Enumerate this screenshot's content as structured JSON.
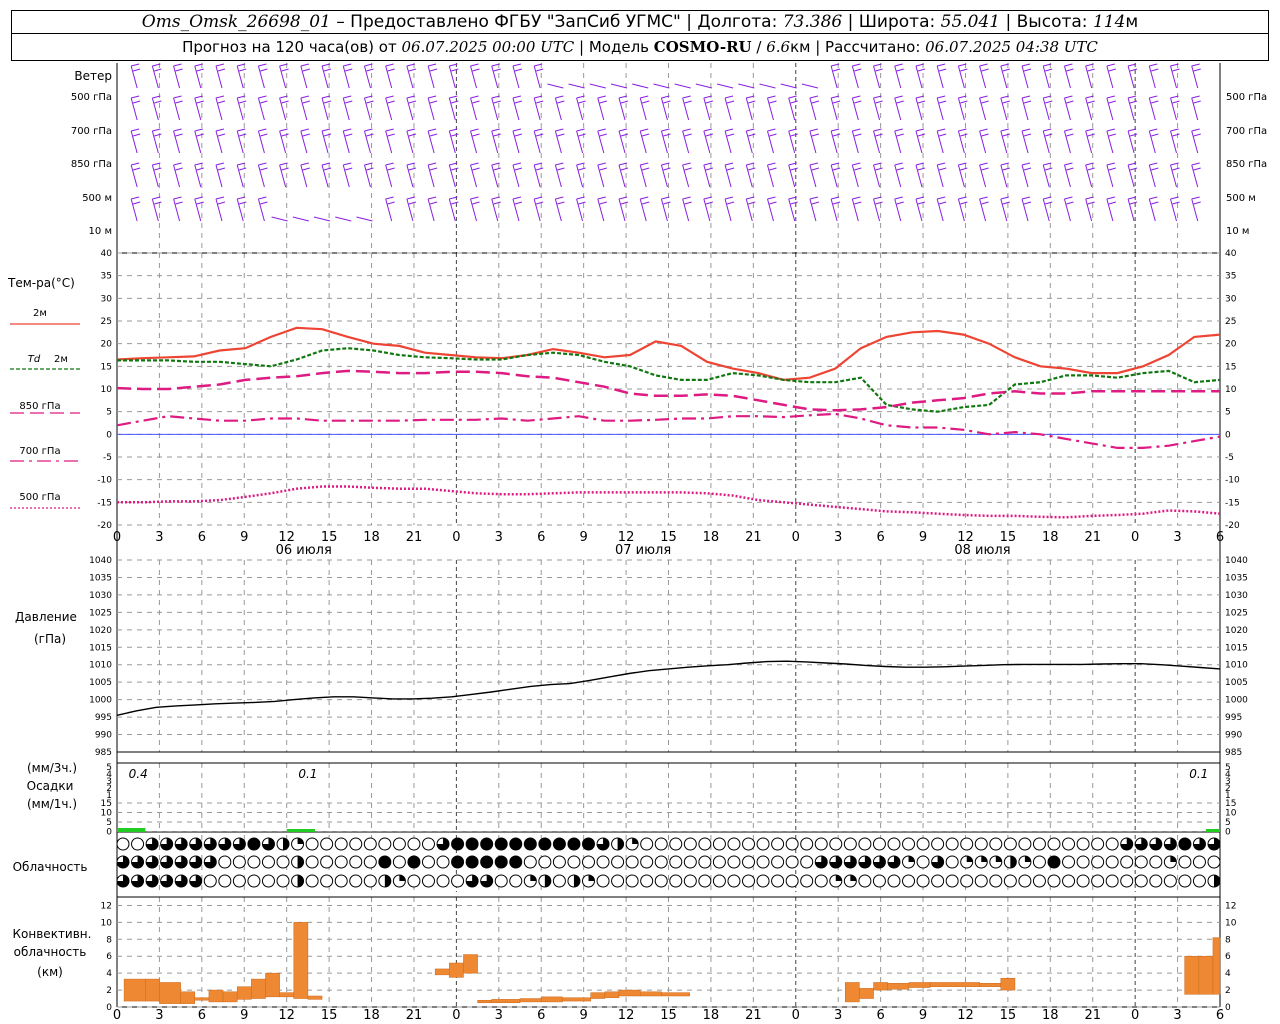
{
  "header": {
    "station": "Oms_Omsk_26698_01",
    "provider": " – Предоставлено ФГБУ \"ЗапСиб УГМС\" | Долгота: ",
    "lon": "73.386",
    "lat_label": " | Широта: ",
    "lat": "55.041",
    "alt_label": " | Высота: ",
    "alt": "114",
    "alt_unit": "м",
    "forecast_prefix": "Прогноз на 120 часа(ов) от ",
    "forecast_from": "06.07.2025 00:00 UTC",
    "model_label": " | Модель ",
    "model": "COSMO-RU",
    "model_sep": " / ",
    "res": "6.6",
    "res_unit": "км",
    "calc_label": " | Рассчитано: ",
    "calc_time": "06.07.2025 04:38 UTC"
  },
  "colors": {
    "wind": "#8a1ee0",
    "t2m": "#ee4433",
    "td2m": "#117711",
    "t850": "#dd1b83",
    "t700": "#dd1b83",
    "t500": "#dd1b83",
    "zero": "#4455ff",
    "precip": "#22cc22",
    "conv": "#ee8833",
    "grid": "#999999"
  },
  "chart_data": {
    "type": "line",
    "x_hours": [
      0,
      3,
      6,
      9,
      12,
      15,
      18,
      21,
      24,
      27,
      30,
      33,
      36,
      39,
      42,
      45,
      48,
      51,
      54,
      57,
      60,
      63,
      66,
      69,
      72,
      75,
      78
    ],
    "x_tick_labels": [
      "0",
      "3",
      "6",
      "9",
      "12",
      "15",
      "18",
      "21",
      "0",
      "3",
      "6",
      "9",
      "12",
      "15",
      "18",
      "21",
      "0",
      "3",
      "6",
      "9",
      "12",
      "15",
      "18",
      "21",
      "0",
      "3",
      "6"
    ],
    "day_labels": [
      {
        "label": "06 июля",
        "hour": 12
      },
      {
        "label": "07 июля",
        "hour": 36
      },
      {
        "label": "08 июля",
        "hour": 60
      }
    ],
    "wind": {
      "label": "Ветер",
      "levels": [
        "500 гПа",
        "700 гПа",
        "850 гПа",
        "500 м",
        "10  м"
      ]
    },
    "temperature": {
      "title": "Тем-ра(°С)",
      "ylim": [
        -20,
        40
      ],
      "ticks": [
        40,
        35,
        30,
        25,
        20,
        15,
        10,
        5,
        0,
        -5,
        -10,
        -15,
        -20
      ],
      "series": [
        {
          "key": "t2m",
          "name": "2м",
          "values": [
            16.5,
            16.8,
            17.0,
            17.2,
            18.5,
            19.0,
            21.5,
            23.5,
            23.2,
            21.5,
            20.0,
            19.5,
            18.0,
            17.5,
            17.0,
            16.8,
            17.5,
            18.8,
            18.0,
            17.0,
            17.5,
            20.5,
            19.5,
            16.0,
            14.5,
            13.5,
            12.0,
            12.5,
            14.5,
            19.0,
            21.5,
            22.5,
            22.8,
            22.0,
            20.0,
            17.0,
            15.0,
            14.5,
            13.5,
            13.5,
            15.0,
            17.5,
            21.5,
            22.0
          ]
        },
        {
          "key": "td2m",
          "name": "2м",
          "prefix": "Td",
          "values": [
            16.3,
            16.3,
            16.3,
            16.0,
            16.0,
            15.5,
            15.0,
            16.5,
            18.5,
            19.0,
            18.5,
            17.5,
            17.0,
            16.8,
            16.5,
            16.5,
            17.5,
            18.0,
            17.5,
            16.0,
            15.0,
            13.0,
            12.0,
            12.0,
            13.5,
            13.0,
            12.0,
            11.5,
            11.5,
            12.5,
            6.5,
            5.5,
            5.0,
            6.0,
            6.5,
            11.0,
            11.5,
            13.0,
            13.0,
            12.5,
            13.5,
            14.0,
            11.5,
            12.0
          ]
        },
        {
          "key": "t850",
          "name": "850 гПа",
          "values": [
            10.2,
            10.0,
            10.0,
            10.5,
            11.0,
            12.0,
            12.5,
            12.8,
            13.5,
            14.0,
            13.8,
            13.5,
            13.5,
            13.8,
            13.8,
            13.5,
            12.8,
            12.5,
            11.5,
            10.5,
            9.0,
            8.5,
            8.5,
            8.8,
            8.5,
            7.5,
            6.5,
            5.5,
            5.3,
            5.5,
            6.0,
            7.0,
            7.5,
            8.0,
            9.0,
            9.5,
            9.0,
            9.0,
            9.5,
            9.5,
            9.5,
            9.5,
            9.5,
            9.5
          ]
        },
        {
          "key": "t700",
          "name": "700 гПа",
          "values": [
            2.0,
            3.0,
            4.0,
            3.5,
            3.0,
            3.0,
            3.5,
            3.5,
            3.0,
            3.0,
            3.0,
            3.0,
            3.2,
            3.2,
            3.2,
            3.5,
            3.0,
            3.5,
            4.0,
            3.0,
            3.0,
            3.2,
            3.5,
            3.5,
            4.0,
            4.0,
            3.8,
            4.2,
            4.5,
            3.5,
            2.0,
            1.5,
            1.5,
            1.0,
            0.0,
            0.5,
            0.0,
            -1.0,
            -2.0,
            -3.0,
            -3.0,
            -2.5,
            -1.5,
            -0.5
          ]
        },
        {
          "key": "t500",
          "name": "500 гПа",
          "values": [
            -15.0,
            -15.0,
            -14.8,
            -14.8,
            -14.5,
            -13.8,
            -13.0,
            -12.0,
            -11.5,
            -11.5,
            -11.8,
            -12.0,
            -12.0,
            -12.5,
            -13.0,
            -13.2,
            -13.2,
            -13.0,
            -12.8,
            -12.8,
            -12.8,
            -12.8,
            -12.8,
            -13.0,
            -13.5,
            -14.5,
            -15.0,
            -15.5,
            -16.0,
            -16.5,
            -17.0,
            -17.2,
            -17.5,
            -17.8,
            -18.0,
            -18.0,
            -18.2,
            -18.3,
            -18.0,
            -17.8,
            -17.5,
            -16.8,
            -17.0,
            -17.5
          ]
        }
      ]
    },
    "pressure": {
      "title": "Давление",
      "unit": "(гПа)",
      "ylim": [
        985,
        1040
      ],
      "ticks": [
        1040,
        1035,
        1030,
        1025,
        1020,
        1015,
        1010,
        1005,
        1000,
        995,
        990,
        985
      ],
      "values": [
        995.5,
        996.8,
        997.8,
        998.2,
        998.5,
        998.8,
        999.0,
        999.2,
        999.5,
        1000.0,
        1000.5,
        1000.8,
        1000.8,
        1000.5,
        1000.2,
        1000.2,
        1000.4,
        1000.8,
        1001.5,
        1002.2,
        1003.0,
        1003.8,
        1004.3,
        1004.6,
        1005.5,
        1006.5,
        1007.5,
        1008.3,
        1008.8,
        1009.3,
        1009.7,
        1010.0,
        1010.5,
        1010.9,
        1011.0,
        1010.8,
        1010.5,
        1010.2,
        1009.8,
        1009.5,
        1009.3,
        1009.3,
        1009.4,
        1009.6,
        1009.8,
        1010.0,
        1010.1,
        1010.1,
        1010.1,
        1010.1,
        1010.2,
        1010.3,
        1010.3,
        1010.0,
        1009.6,
        1009.2,
        1008.8
      ]
    },
    "precipitation": {
      "label_3h": "(мм/3ч.)",
      "title": "Осадки",
      "label_1h": "(мм/1ч.)",
      "ticks_upper": [
        5,
        4,
        3,
        2,
        1
      ],
      "ticks_lower": [
        15,
        10,
        5,
        0
      ],
      "annotations": [
        {
          "text": "0.4",
          "hour": 1.5
        },
        {
          "text": "0.1",
          "hour": 13.5
        },
        {
          "text": "0.1",
          "hour": 76.5
        }
      ],
      "bars": [
        {
          "start": 0,
          "end": 2,
          "value": 1.0
        },
        {
          "start": 12,
          "end": 14,
          "value": 0.4
        },
        {
          "start": 77,
          "end": 78,
          "value": 0.6
        }
      ]
    },
    "cloudiness": {
      "title": "Облачность",
      "rows": [
        "0033333334321000000000344444444443210000000000000000000000000000000003333433",
        "3333333000002000004040044444000000000000000000003333331030111210400000001000",
        "3333330000002000002100003300120210000000000000000110000000000000000000000002"
      ]
    },
    "convective": {
      "title_1": "Конвективн.",
      "title_2": "облачность",
      "unit": "(км)",
      "ylim": [
        0,
        13
      ],
      "ticks": [
        12,
        10,
        8,
        6,
        4,
        2,
        0
      ],
      "bars": [
        {
          "start": 0.5,
          "end": 2,
          "bottom": 0.7,
          "top": 3.3
        },
        {
          "start": 2,
          "end": 3,
          "bottom": 0.7,
          "top": 3.3
        },
        {
          "start": 3,
          "end": 4.5,
          "bottom": 0.4,
          "top": 2.9
        },
        {
          "start": 4.5,
          "end": 5.5,
          "bottom": 0.4,
          "top": 1.8
        },
        {
          "start": 5.5,
          "end": 6.5,
          "bottom": 0.8,
          "top": 1.1
        },
        {
          "start": 6.5,
          "end": 7.5,
          "bottom": 0.6,
          "top": 2.0
        },
        {
          "start": 7.5,
          "end": 8.5,
          "bottom": 0.6,
          "top": 1.8
        },
        {
          "start": 8.5,
          "end": 9.5,
          "bottom": 0.9,
          "top": 2.4
        },
        {
          "start": 9.5,
          "end": 10.5,
          "bottom": 1.0,
          "top": 3.3
        },
        {
          "start": 10.5,
          "end": 11.5,
          "bottom": 1.2,
          "top": 4.0
        },
        {
          "start": 11.5,
          "end": 12.5,
          "bottom": 1.2,
          "top": 1.7
        },
        {
          "start": 12.5,
          "end": 13.5,
          "bottom": 1.0,
          "top": 10.0
        },
        {
          "start": 13.5,
          "end": 14.5,
          "bottom": 0.9,
          "top": 1.3
        },
        {
          "start": 22.5,
          "end": 23.5,
          "bottom": 3.8,
          "top": 4.5
        },
        {
          "start": 23.5,
          "end": 24.5,
          "bottom": 3.5,
          "top": 5.2
        },
        {
          "start": 24.5,
          "end": 25.5,
          "bottom": 4.0,
          "top": 6.2
        },
        {
          "start": 25.5,
          "end": 26.5,
          "bottom": 0.5,
          "top": 0.8
        },
        {
          "start": 26.5,
          "end": 28.5,
          "bottom": 0.5,
          "top": 0.9
        },
        {
          "start": 28.5,
          "end": 30,
          "bottom": 0.6,
          "top": 1.0
        },
        {
          "start": 30,
          "end": 31.5,
          "bottom": 0.6,
          "top": 1.2
        },
        {
          "start": 31.5,
          "end": 33.5,
          "bottom": 0.7,
          "top": 1.1
        },
        {
          "start": 33.5,
          "end": 34.5,
          "bottom": 1.0,
          "top": 1.7
        },
        {
          "start": 34.5,
          "end": 35.5,
          "bottom": 1.1,
          "top": 1.8
        },
        {
          "start": 35.5,
          "end": 37,
          "bottom": 1.3,
          "top": 2.0
        },
        {
          "start": 37,
          "end": 38.5,
          "bottom": 1.3,
          "top": 1.8
        },
        {
          "start": 38.5,
          "end": 40.5,
          "bottom": 1.3,
          "top": 1.7
        },
        {
          "start": 51.5,
          "end": 52.5,
          "bottom": 0.6,
          "top": 2.9
        },
        {
          "start": 52.5,
          "end": 53.5,
          "bottom": 1.0,
          "top": 2.2
        },
        {
          "start": 53.5,
          "end": 54.5,
          "bottom": 2.0,
          "top": 2.9
        },
        {
          "start": 54.5,
          "end": 56,
          "bottom": 2.1,
          "top": 2.8
        },
        {
          "start": 56,
          "end": 57.5,
          "bottom": 2.3,
          "top": 2.9
        },
        {
          "start": 57.5,
          "end": 61,
          "bottom": 2.4,
          "top": 2.9
        },
        {
          "start": 61,
          "end": 62.5,
          "bottom": 2.4,
          "top": 2.8
        },
        {
          "start": 62.5,
          "end": 63.5,
          "bottom": 2.0,
          "top": 3.4
        },
        {
          "start": 75.5,
          "end": 76.5,
          "bottom": 1.5,
          "top": 6.0
        },
        {
          "start": 76.5,
          "end": 77.5,
          "bottom": 1.5,
          "top": 6.0
        },
        {
          "start": 77.5,
          "end": 78,
          "bottom": 1.5,
          "top": 8.2
        }
      ]
    }
  }
}
